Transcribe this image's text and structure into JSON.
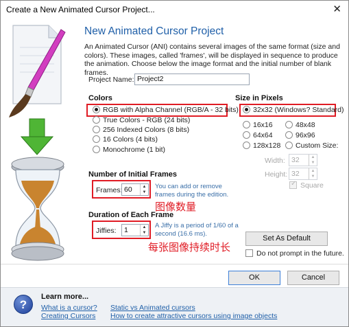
{
  "window": {
    "title": "Create a New Animated Cursor Project...",
    "close_glyph": "✕"
  },
  "heading": "New Animated Cursor Project",
  "intro": "An Animated Cursor (ANI) contains several images of the same format (size and colors). These images, called 'frames', will be displayed in sequence to produce the animation. Choose below the image format and the initial number of blank frames.",
  "project_name": {
    "label": "Project Name:",
    "value": "Project2"
  },
  "colors": {
    "title": "Colors",
    "options": [
      {
        "label": "RGB with Alpha Channel (RGB/A - 32 bits)",
        "selected": true
      },
      {
        "label": "True Colors - RGB (24 bits)",
        "selected": false
      },
      {
        "label": "256 Indexed Colors (8 bits)",
        "selected": false
      },
      {
        "label": "16 Colors (4 bits)",
        "selected": false
      },
      {
        "label": "Monochrome (1 bit)",
        "selected": false
      }
    ]
  },
  "size": {
    "title": "Size in Pixels",
    "selected_label": "32x32 (Windows? Standard)",
    "options": [
      {
        "label": "16x16"
      },
      {
        "label": "48x48"
      },
      {
        "label": "64x64"
      },
      {
        "label": "96x96"
      },
      {
        "label": "128x128"
      },
      {
        "label": "Custom Size:"
      }
    ],
    "width": {
      "label": "Width:",
      "value": "32"
    },
    "height": {
      "label": "Height:",
      "value": "32"
    },
    "square_label": "Square"
  },
  "frames": {
    "title": "Number of Initial Frames",
    "label": "Frames:",
    "value": "60",
    "hint": "You can add or remove frames during the edition.",
    "annotation": "图像数量"
  },
  "duration": {
    "title": "Duration of Each Frame",
    "label": "Jiffies:",
    "value": "1",
    "hint": "A Jiffy is a period of 1/60 of a second (16.6 ms).",
    "annotation": "每张图像持续时长"
  },
  "buttons": {
    "set_default": "Set As Default",
    "ok": "OK",
    "cancel": "Cancel"
  },
  "do_not_prompt": "Do not prompt in the future.",
  "footer": {
    "learn_more": "Learn more...",
    "links": [
      "What is a cursor?",
      "Creating Cursors",
      "Static vs Animated cursors",
      "How to create attractive cursors using image objects"
    ]
  },
  "colors_theme": {
    "accent": "#1f5fa8",
    "annotation_red": "#e01b24"
  }
}
